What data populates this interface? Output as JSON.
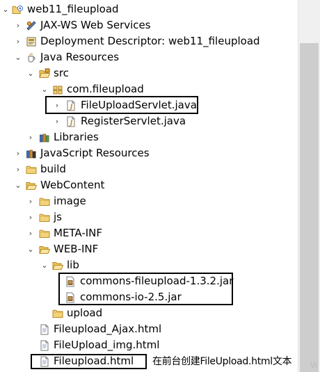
{
  "tree": {
    "project": "web11_fileupload",
    "jaxws": "JAX-WS Web Services",
    "deployment": "Deployment Descriptor: web11_fileupload",
    "java_resources": "Java Resources",
    "src": "src",
    "package": "com.fileupload",
    "file_upload_servlet": "FileUploadServlet.java",
    "register_servlet": "RegisterServlet.java",
    "libraries": "Libraries",
    "javascript_resources": "JavaScript Resources",
    "build": "build",
    "webcontent": "WebContent",
    "image": "image",
    "js": "js",
    "meta_inf": "META-INF",
    "web_inf": "WEB-INF",
    "lib": "lib",
    "jar1": "commons-fileupload-1.3.2.jar",
    "jar2": "commons-io-2.5.jar",
    "upload": "upload",
    "html1": "Fileupload_Ajax.html",
    "html2": "FileUpload_img.html",
    "html3": "Fileupload.html"
  },
  "annotation": "在前台创建FileUpload.html文本",
  "watermark": "Vi",
  "colors": {
    "folder": "#e8c15b",
    "java": "#c2902a",
    "highlight_box": "#000000"
  }
}
